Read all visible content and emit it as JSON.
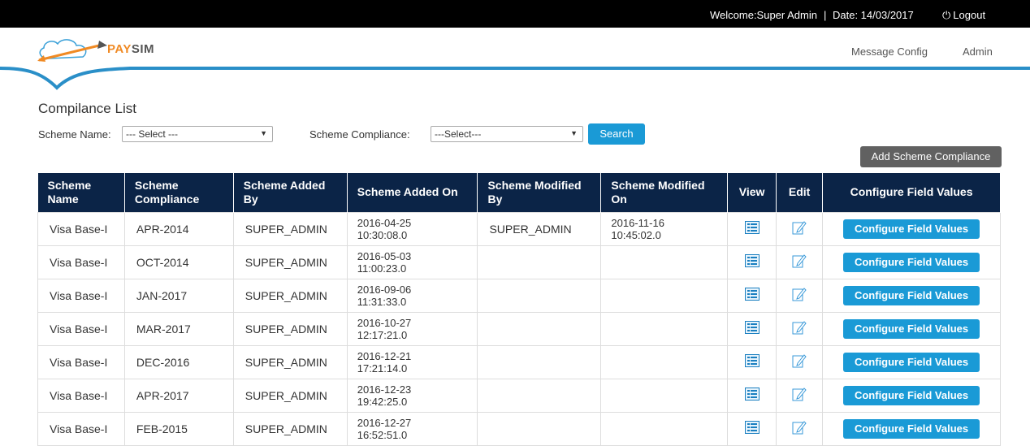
{
  "topbar": {
    "welcome": "Welcome:Super Admin",
    "separator": "|",
    "date": "Date: 14/03/2017",
    "logout": "Logout"
  },
  "brand": {
    "pay": "PAY",
    "sim": "SIM"
  },
  "nav": {
    "message_config": "Message Config",
    "admin": "Admin"
  },
  "page": {
    "title": "Compilance List"
  },
  "filters": {
    "scheme_name_label": "Scheme Name:",
    "scheme_name_value": "--- Select ---",
    "scheme_compliance_label": "Scheme Compliance:",
    "scheme_compliance_value": "---Select---",
    "search_label": "Search"
  },
  "add_button": "Add Scheme Compliance",
  "table": {
    "headers": {
      "scheme_name": [
        "Scheme",
        "Name"
      ],
      "scheme_compliance": [
        "Scheme",
        "Compliance"
      ],
      "added_by": [
        "Scheme Added",
        "By"
      ],
      "added_on": "Scheme Added On",
      "modified_by": [
        "Scheme Modified",
        "By"
      ],
      "modified_on": [
        "Scheme Modified",
        "On"
      ],
      "view": "View",
      "edit": "Edit",
      "configure": "Configure Field Values"
    },
    "configure_button": "Configure Field Values",
    "rows": [
      {
        "name": "Visa Base-I",
        "compliance": "APR-2014",
        "added_by": "SUPER_ADMIN",
        "added_on_date": "2016-04-25",
        "added_on_time": "10:30:08.0",
        "modified_by": "SUPER_ADMIN",
        "modified_on_date": "2016-11-16",
        "modified_on_time": "10:45:02.0"
      },
      {
        "name": "Visa Base-I",
        "compliance": "OCT-2014",
        "added_by": "SUPER_ADMIN",
        "added_on_date": "2016-05-03",
        "added_on_time": "11:00:23.0",
        "modified_by": "",
        "modified_on_date": "",
        "modified_on_time": ""
      },
      {
        "name": "Visa Base-I",
        "compliance": "JAN-2017",
        "added_by": "SUPER_ADMIN",
        "added_on_date": "2016-09-06",
        "added_on_time": "11:31:33.0",
        "modified_by": "",
        "modified_on_date": "",
        "modified_on_time": ""
      },
      {
        "name": "Visa Base-I",
        "compliance": "MAR-2017",
        "added_by": "SUPER_ADMIN",
        "added_on_date": "2016-10-27",
        "added_on_time": "12:17:21.0",
        "modified_by": "",
        "modified_on_date": "",
        "modified_on_time": ""
      },
      {
        "name": "Visa Base-I",
        "compliance": "DEC-2016",
        "added_by": "SUPER_ADMIN",
        "added_on_date": "2016-12-21",
        "added_on_time": "17:21:14.0",
        "modified_by": "",
        "modified_on_date": "",
        "modified_on_time": ""
      },
      {
        "name": "Visa Base-I",
        "compliance": "APR-2017",
        "added_by": "SUPER_ADMIN",
        "added_on_date": "2016-12-23",
        "added_on_time": "19:42:25.0",
        "modified_by": "",
        "modified_on_date": "",
        "modified_on_time": ""
      },
      {
        "name": "Visa Base-I",
        "compliance": "FEB-2015",
        "added_by": "SUPER_ADMIN",
        "added_on_date": "2016-12-27",
        "added_on_time": "16:52:51.0",
        "modified_by": "",
        "modified_on_date": "",
        "modified_on_time": ""
      }
    ]
  },
  "colors": {
    "header_bg": "#0b2447",
    "accent": "#1a9ad6",
    "topbar": "#000000",
    "brand_orange": "#f08a24"
  }
}
